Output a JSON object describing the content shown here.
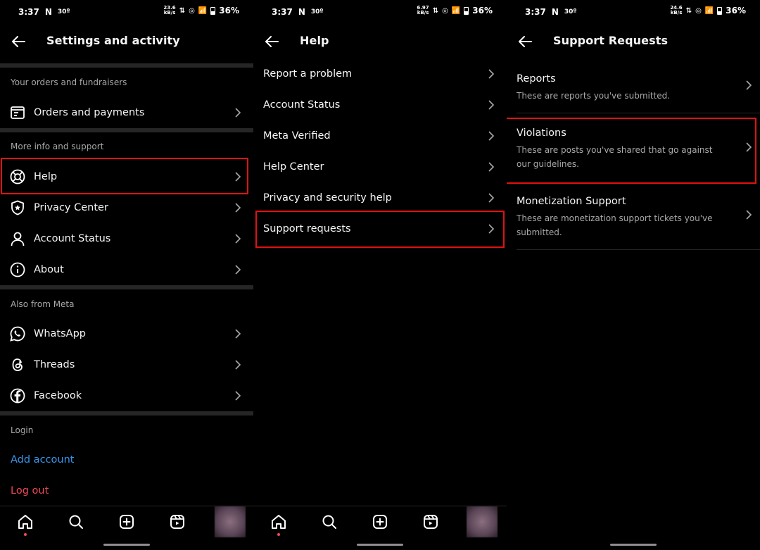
{
  "status": {
    "time": "3:37",
    "carrier": "N",
    "temp": "30º",
    "battery": "36%",
    "speeds": [
      {
        "value": "23.6",
        "unit": "kB/s"
      },
      {
        "value": "6.97",
        "unit": "kB/s"
      },
      {
        "value": "24.6",
        "unit": "kB/s"
      }
    ]
  },
  "panel1": {
    "title": "Settings and activity",
    "sections": [
      {
        "label": "Your orders and fundraisers"
      },
      {
        "label": "More info and support"
      },
      {
        "label": "Also from Meta"
      },
      {
        "label": "Login"
      }
    ],
    "items": [
      {
        "label": "Orders and payments",
        "icon": "receipt-icon"
      },
      {
        "label": "Help",
        "icon": "lifebuoy-icon"
      },
      {
        "label": "Privacy Center",
        "icon": "shield-star-icon"
      },
      {
        "label": "Account Status",
        "icon": "person-icon"
      },
      {
        "label": "About",
        "icon": "info-icon"
      },
      {
        "label": "WhatsApp",
        "icon": "whatsapp-icon"
      },
      {
        "label": "Threads",
        "icon": "threads-icon"
      },
      {
        "label": "Facebook",
        "icon": "facebook-icon"
      }
    ],
    "add_account": "Add account",
    "log_out": "Log out"
  },
  "panel2": {
    "title": "Help",
    "items": [
      {
        "label": "Report a problem"
      },
      {
        "label": "Account Status"
      },
      {
        "label": "Meta Verified"
      },
      {
        "label": "Help Center"
      },
      {
        "label": "Privacy and security help"
      },
      {
        "label": "Support requests"
      }
    ]
  },
  "panel3": {
    "title": "Support Requests",
    "items": [
      {
        "title": "Reports",
        "subtitle": "These are reports you've submitted."
      },
      {
        "title": "Violations",
        "subtitle": "These are posts you've shared that go against our guidelines."
      },
      {
        "title": "Monetization Support",
        "subtitle": "These are monetization support tickets you've submitted."
      }
    ]
  },
  "colors": {
    "background": "#000000",
    "separator": "#262626",
    "highlight": "#e01212",
    "link_blue": "#3897f0",
    "link_red": "#ed4956"
  }
}
